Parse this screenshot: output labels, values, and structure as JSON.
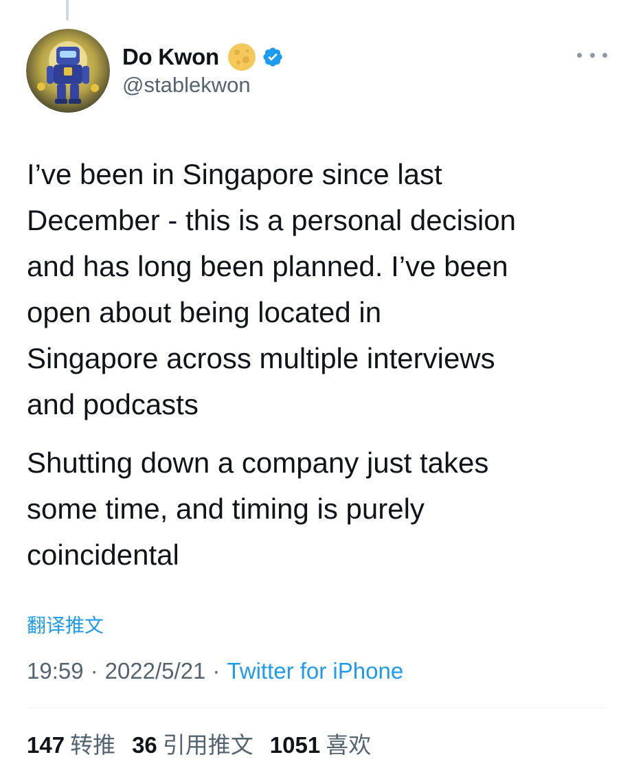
{
  "user": {
    "display_name": "Do Kwon",
    "handle": "@stablekwon",
    "badge_icon": "moon-emoji-icon",
    "verified_icon": "verified-badge-icon",
    "verified_color": "#1d9bf0"
  },
  "tweet": {
    "paragraphs": [
      "I’ve been in Singapore since last\nDecember - this is a personal decision\nand has long been planned. I’ve been\nopen about being located in\nSingapore across multiple interviews\nand podcasts",
      "Shutting down a company just takes\nsome time, and timing is purely\ncoincidental"
    ],
    "translate_label": "翻译推文",
    "time": "19:59",
    "date": "2022/5/21",
    "separator": "·",
    "source": "Twitter for iPhone"
  },
  "stats": {
    "retweets": {
      "count": "147",
      "label": "转推"
    },
    "quotes": {
      "count": "36",
      "label": "引用推文"
    },
    "likes": {
      "count": "1051",
      "label": "喜欢"
    }
  },
  "colors": {
    "link": "#1d9bf0",
    "secondary_text": "#536471",
    "primary_text": "#0f1419"
  }
}
